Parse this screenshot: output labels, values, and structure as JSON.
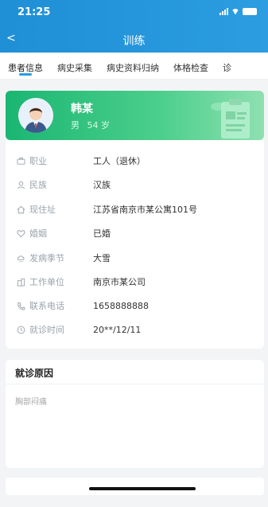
{
  "status": {
    "time": "21:25"
  },
  "header": {
    "title": "训练",
    "back": "<"
  },
  "tabs": [
    {
      "label": "患者信息",
      "active": true
    },
    {
      "label": "病史采集"
    },
    {
      "label": "病史资料归纳"
    },
    {
      "label": "体格检查"
    },
    {
      "label": "诊"
    }
  ],
  "profile": {
    "name": "韩某",
    "gender": "男",
    "age": "54 岁"
  },
  "info": [
    {
      "icon": "briefcase-icon",
      "label": "职业",
      "value": "工人（退休）"
    },
    {
      "icon": "person-icon",
      "label": "民族",
      "value": "汉族"
    },
    {
      "icon": "home-icon",
      "label": "现住址",
      "value": "江苏省南京市某公寓101号"
    },
    {
      "icon": "heart-icon",
      "label": "婚姻",
      "value": "已婚"
    },
    {
      "icon": "weather-icon",
      "label": "发病季节",
      "value": "大雪"
    },
    {
      "icon": "building-icon",
      "label": "工作单位",
      "value": "南京市某公司"
    },
    {
      "icon": "phone-icon",
      "label": "联系电话",
      "value": "1658888888"
    },
    {
      "icon": "clock-icon",
      "label": "就诊时间",
      "value": "20**/12/11"
    }
  ],
  "reason": {
    "title": "就诊原因",
    "text": "胸部闷痛"
  },
  "colors": {
    "header": "#2b9de0",
    "profile": "#1ab672",
    "accent": "#2b9de0"
  }
}
